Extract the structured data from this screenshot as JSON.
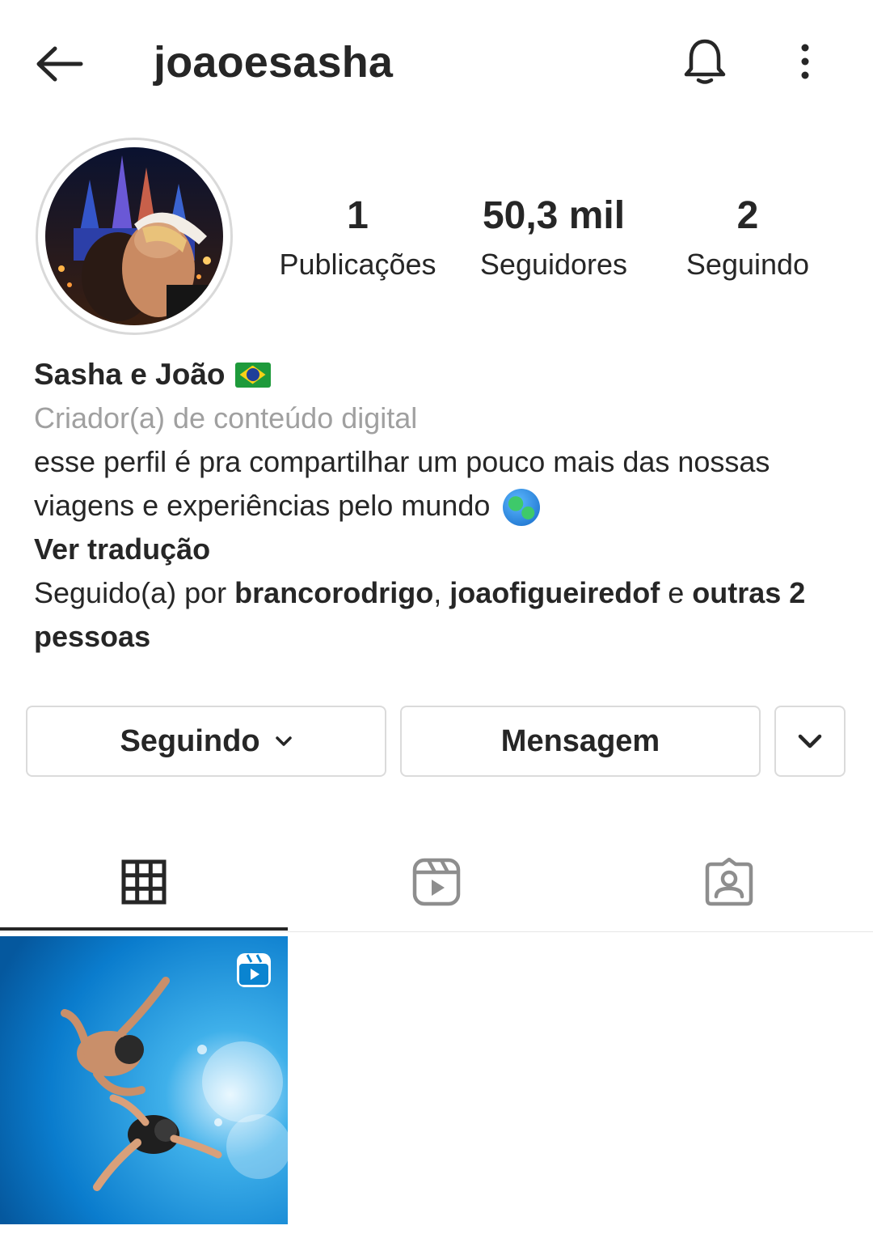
{
  "header": {
    "username": "joaoesasha",
    "back_icon": "arrow-left-icon",
    "notification_icon": "bell-icon",
    "more_icon": "more-vertical-icon"
  },
  "profile": {
    "stats": {
      "posts_count": "1",
      "posts_label": "Publicações",
      "followers_count": "50,3 mil",
      "followers_label": "Seguidores",
      "following_count": "2",
      "following_label": "Seguindo"
    },
    "bio": {
      "full_name": "Sasha e João",
      "category": "Criador(a) de conteúdo digital",
      "text": "esse perfil é pra compartilhar um pouco mais das nossas viagens e experiências pelo mundo",
      "translate_link": "Ver tradução",
      "followed_by_prefix": "Seguido(a) por",
      "followed_by_user1": "brancorodrigo",
      "followed_by_separator": ",",
      "followed_by_user2": "joaofigueiredof",
      "followed_by_and": "e",
      "followed_by_others": "outras 2 pessoas"
    }
  },
  "actions": {
    "following_label": "Seguindo",
    "message_label": "Mensagem",
    "suggestions_icon": "chevron-down-icon"
  },
  "tabs": [
    {
      "name": "grid",
      "icon": "grid-icon",
      "active": true
    },
    {
      "name": "reels",
      "icon": "reels-icon",
      "active": false
    },
    {
      "name": "tagged",
      "icon": "tagged-person-icon",
      "active": false
    }
  ],
  "colors": {
    "text": "#262626",
    "secondary_text": "#a0a0a0",
    "border": "#dbdbdb"
  }
}
